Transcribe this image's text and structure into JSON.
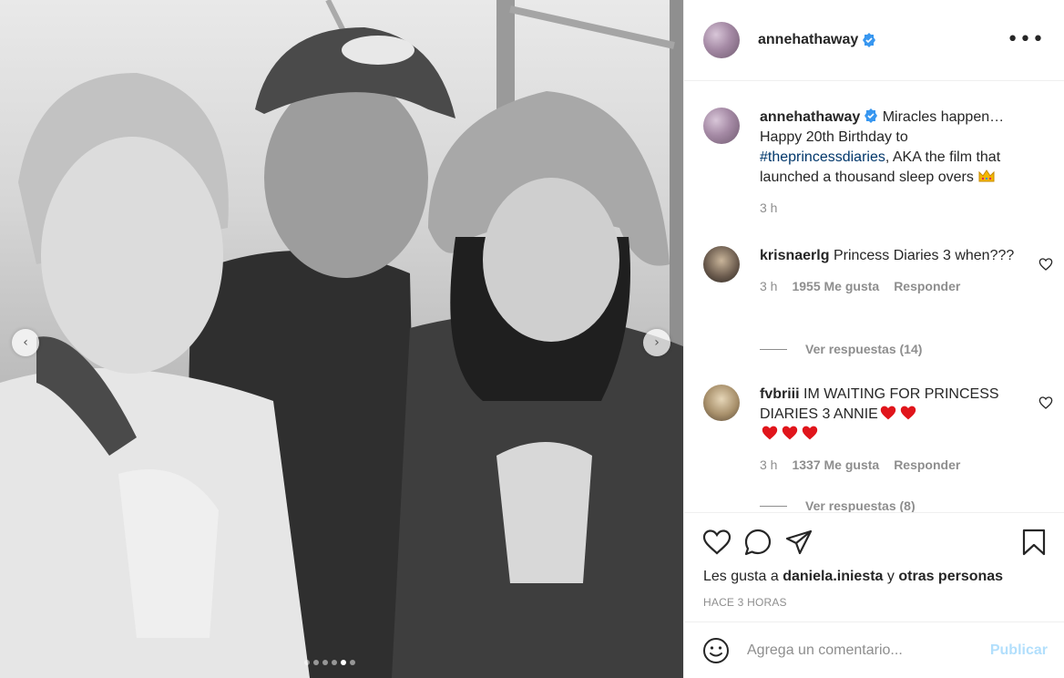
{
  "post": {
    "username": "annehathaway",
    "more_icon": "more-horizontal-icon",
    "caption_prefix": "Miracles happen…",
    "caption_line2": "Happy 20th Birthday to",
    "caption_hashtag": "#theprincessdiaries",
    "caption_suffix": ", AKA the film that launched a thousand sleep overs",
    "caption_time": "3 h"
  },
  "comments": [
    {
      "username": "krisnaerlg",
      "text": "Princess Diaries 3 when???",
      "time": "3 h",
      "likes": "1955 Me gusta",
      "reply": "Responder",
      "view_replies": "Ver respuestas (14)"
    },
    {
      "username": "fvbriii",
      "text": "IM WAITING FOR PRINCESS DIARIES 3 ANNIE",
      "time": "3 h",
      "likes": "1337 Me gusta",
      "reply": "Responder",
      "view_replies": "Ver respuestas (8)"
    }
  ],
  "actions": {
    "likes_prefix": "Les gusta a",
    "likes_user": "daniela.iniesta",
    "likes_middle": "y",
    "likes_others": "otras personas",
    "time": "HACE 3 HORAS"
  },
  "add_comment": {
    "placeholder": "Agrega un comentario...",
    "publish_label": "Publicar"
  },
  "carousel": {
    "total_dots": 6,
    "active_dot": 5
  },
  "colors": {
    "verified": "#3897f0",
    "hashtag": "#00376b",
    "publish_disabled": "#b2dffc"
  }
}
